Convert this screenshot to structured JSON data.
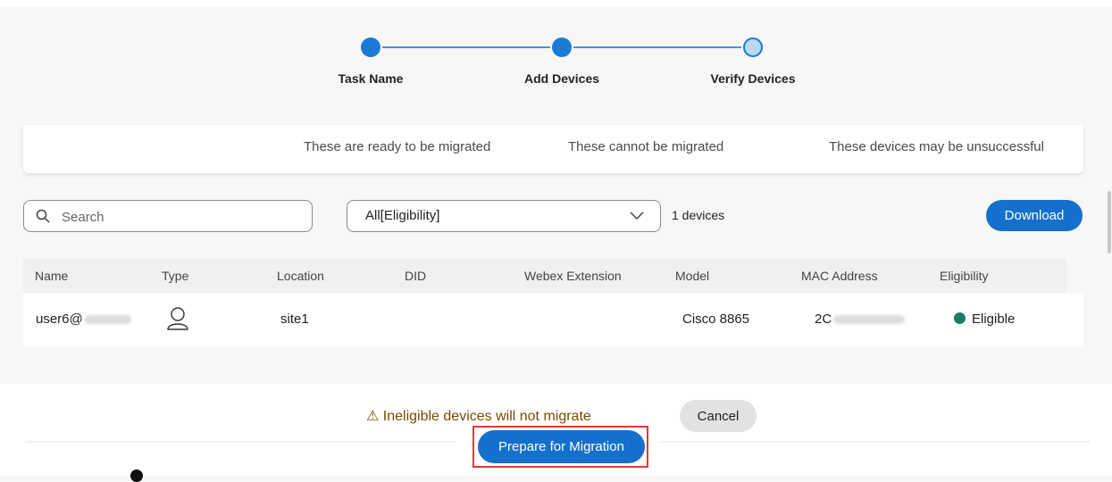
{
  "stepper": {
    "steps": [
      {
        "label": "Task Name",
        "state": "done"
      },
      {
        "label": "Add Devices",
        "state": "done"
      },
      {
        "label": "Verify Devices",
        "state": "current"
      }
    ]
  },
  "summary": {
    "ready": "These are ready to be migrated",
    "cannot": "These cannot be migrated",
    "may_fail": "These devices may be unsuccessful"
  },
  "toolbar": {
    "search_placeholder": "Search",
    "filter_value": "All[Eligibility]",
    "device_count": "1 devices",
    "download_label": "Download"
  },
  "table": {
    "columns": [
      "Name",
      "Type",
      "Location",
      "DID",
      "Webex Extension",
      "Model",
      "MAC Address",
      "Eligibility"
    ],
    "rows": [
      {
        "name": "user6@",
        "type_icon": "user-icon",
        "location": "site1",
        "did": "",
        "webex_extension": "",
        "model": "Cisco 8865",
        "mac_address": "2C",
        "eligibility": "Eligible"
      }
    ]
  },
  "footer": {
    "warning": "⚠ Ineligible devices will not migrate",
    "cancel_label": "Cancel",
    "prepare_label": "Prepare for Migration"
  },
  "colors": {
    "primary": "#1470cc",
    "eligible": "#1d7a64",
    "warning_text": "#7a4a00",
    "highlight": "#e53935"
  }
}
